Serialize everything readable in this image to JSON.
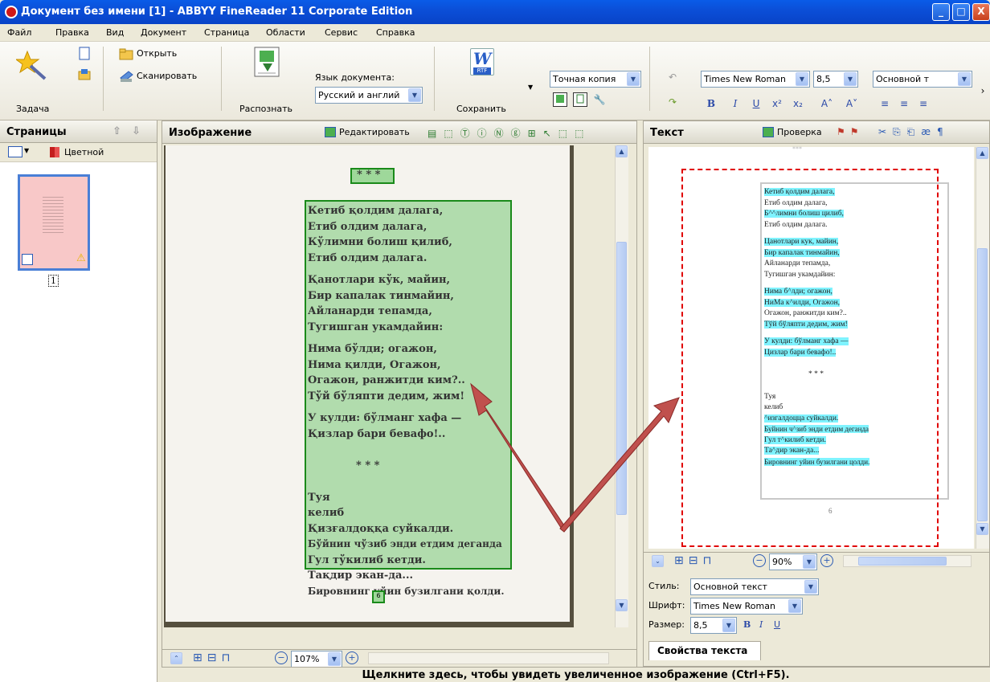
{
  "window": {
    "title": "Документ без имени [1] - ABBYY FineReader 11 Corporate Edition",
    "min": "_",
    "max": "□",
    "close": "X"
  },
  "menu": [
    "Файл",
    "Правка",
    "Вид",
    "Документ",
    "Страница",
    "Области",
    "Сервис",
    "Справка"
  ],
  "toolbar": {
    "task_label": "Задача",
    "open_label": "Открыть",
    "scan_label": "Сканировать",
    "recognize_label": "Распознать",
    "doc_language_label": "Язык документа:",
    "doc_language_value": "Русский и англий",
    "save_label": "Сохранить",
    "save_format_value": "Точная копия",
    "rtf_badge": "RTF",
    "word_glyph": "W",
    "font_value": "Times New Roman",
    "font_size_value": "8,5",
    "style_value": "Основной т",
    "bold": "B",
    "italic": "I",
    "underline": "U",
    "superscript": "x²",
    "subscript": "x₂",
    "grow_font": "A˄",
    "shrink_font": "A˅",
    "more": "›"
  },
  "pages_panel": {
    "title": "Страницы",
    "color_mode": "Цветной",
    "page_number": "1"
  },
  "image_panel": {
    "title": "Изображение",
    "edit_label": "Редактировать",
    "zoom_value": "107%",
    "header_mark": "* * *",
    "page_num_mark": "6",
    "lines": [
      "Кетиб қолдим далага,",
      "Етиб олдим далага,",
      "Кўлимни болиш қилиб,",
      "Етиб олдим далага.",
      "",
      "Қанотлари кўк, майин,",
      "Бир капалак тинмайин,",
      "Айланарди тепамда,",
      "Тугишган укамдайин:",
      "",
      "Нима бўлди; огажон,",
      "Нима қилди, Огажон,",
      "Огажон, ранжитди ким?..",
      "Тўй бўляпти дедим, жим!",
      "",
      "У кулди: бўлманг хафа —",
      "Қизлар бари бевафо!..",
      "",
      "* * *",
      "",
      "Туя",
      "келиб",
      "Қизғалдоққа суйкалди.",
      "Бўйнин чўзиб энди етдим деганда",
      "Гул тўкилиб кетди.",
      "Тақдир экан-да...",
      "Бировнинг уйин бузилгани қолди."
    ]
  },
  "text_panel": {
    "title": "Текст",
    "verify_label": "Проверка",
    "zoom_value": "90%",
    "top_mark": "***",
    "mid_mark": "* * *",
    "page_num": "6",
    "lines": [
      "Кетиб қолдим далага,",
      "Етиб олдим далага,",
      "Б^^лимни болиш цилиб,",
      "Етиб олдим далага.",
      "",
      "Цанотлари кук, майин,",
      "Бир капалак тинмайин,",
      "Айланарди тепамда,",
      "Тугишган укамдайин:",
      "",
      "Нима б^лди; огажон,",
      "НиМа к^илди, Огажон,",
      "Огажон, ранжитди ким?..",
      "Тўй бўляпти дедим, жим!",
      "",
      "У кулди: бўлманг хафа —",
      "Цизлар бари бевафо!..",
      "",
      "* * *",
      "",
      "Туя",
      "келиб",
      "^изгалдоцца суйкалди.",
      "Буйнин ч^зиб энди етдим деганда",
      "Гул т^килиб кетди.",
      "Та^дир экан-да...",
      "Бировнинг уйин бузилгани цолди."
    ],
    "style_label": "Стиль:",
    "style_value": "Основной текст",
    "font_label": "Шрифт:",
    "font_value": "Times New Roman",
    "size_label": "Размер:",
    "size_value": "8,5",
    "props_tab": "Свойства текста"
  },
  "status": {
    "hint": "Щелкните здесь, чтобы увидеть увеличенное изображение (Ctrl+F5)."
  },
  "colors": {
    "titlebar": "#0a5ce8",
    "area_fill": "#9ed89a",
    "area_border": "#1a8a1a",
    "arrow": "#c0504d",
    "dashed_frame": "#e00000",
    "highlight": "#7ff3ff"
  }
}
